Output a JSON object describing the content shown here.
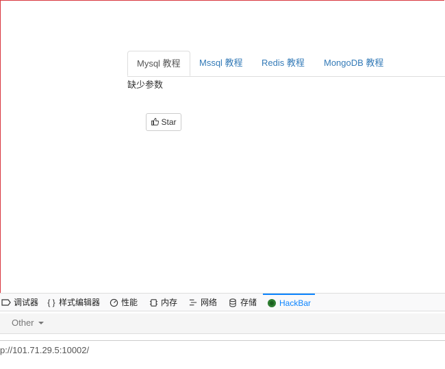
{
  "tabs": [
    {
      "label": "Mysql 教程",
      "active": true
    },
    {
      "label": "Mssql 教程",
      "active": false
    },
    {
      "label": "Redis 教程",
      "active": false
    },
    {
      "label": "MongoDB 教程",
      "active": false
    }
  ],
  "message": "缺少参数",
  "star_button": {
    "label": "Star",
    "icon": "thumbs-up-icon"
  },
  "devtools": {
    "tabs": [
      {
        "label": "调试器",
        "icon": "debugger-icon"
      },
      {
        "label": "样式编辑器",
        "icon": "braces-icon"
      },
      {
        "label": "性能",
        "icon": "performance-icon"
      },
      {
        "label": "内存",
        "icon": "memory-icon"
      },
      {
        "label": "网络",
        "icon": "network-icon"
      },
      {
        "label": "存储",
        "icon": "storage-icon"
      },
      {
        "label": "HackBar",
        "icon": "hackbar-icon",
        "active": true
      }
    ],
    "accent_color": "#0a84ff"
  },
  "hackbar": {
    "menu_other": "Other",
    "url_value": "p://101.71.29.5:10002/"
  }
}
